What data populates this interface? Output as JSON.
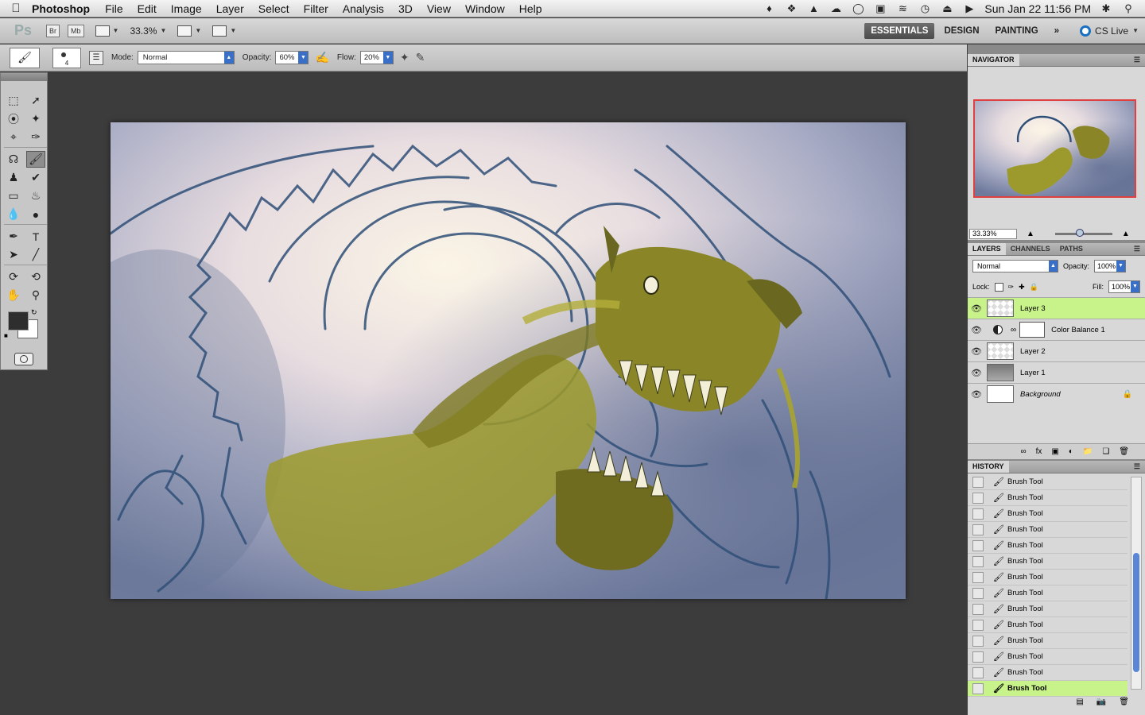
{
  "menubar": {
    "app_name": "Photoshop",
    "items": [
      "File",
      "Edit",
      "Image",
      "Layer",
      "Select",
      "Filter",
      "Analysis",
      "3D",
      "View",
      "Window",
      "Help"
    ],
    "clock": "Sun Jan 22  11:56 PM",
    "tray_icons": [
      "evernote-icon",
      "dropbox-icon",
      "adobe-icon",
      "cloud-icon",
      "chat-icon",
      "display-icon",
      "wifi-icon",
      "time-machine-icon",
      "eject-icon",
      "volume-icon",
      "bluetooth-icon",
      "spotlight-icon"
    ]
  },
  "appbar": {
    "logo": "Ps",
    "bridge": "Br",
    "minibridge": "Mb",
    "zoom": "33.3%",
    "workspaces": [
      "ESSENTIALS",
      "DESIGN",
      "PAINTING"
    ],
    "more": "»",
    "cslive": "CS Live"
  },
  "options": {
    "brush_size": "4",
    "mode_label": "Mode:",
    "mode_value": "Normal",
    "opacity_label": "Opacity:",
    "opacity_value": "60%",
    "flow_label": "Flow:",
    "flow_value": "20%"
  },
  "navigator": {
    "tab": "NAVIGATOR",
    "zoom": "33.33%"
  },
  "layers": {
    "tabs": [
      "LAYERS",
      "CHANNELS",
      "PATHS"
    ],
    "blend_mode": "Normal",
    "opacity_label": "Opacity:",
    "opacity_value": "100%",
    "lock_label": "Lock:",
    "fill_label": "Fill:",
    "fill_value": "100%",
    "items": [
      {
        "name": "Layer 3"
      },
      {
        "name": "Color Balance 1"
      },
      {
        "name": "Layer 2"
      },
      {
        "name": "Layer 1"
      },
      {
        "name": "Background"
      }
    ]
  },
  "history": {
    "tab": "HISTORY",
    "items": [
      "Brush Tool",
      "Brush Tool",
      "Brush Tool",
      "Brush Tool",
      "Brush Tool",
      "Brush Tool",
      "Brush Tool",
      "Brush Tool",
      "Brush Tool",
      "Brush Tool",
      "Brush Tool",
      "Brush Tool",
      "Brush Tool",
      "Brush Tool"
    ]
  },
  "colors": {
    "selection_green": "#c8f28a",
    "accent_blue": "#3a6fc8",
    "foreground": "#2e2e2e",
    "background": "#ffffff"
  }
}
